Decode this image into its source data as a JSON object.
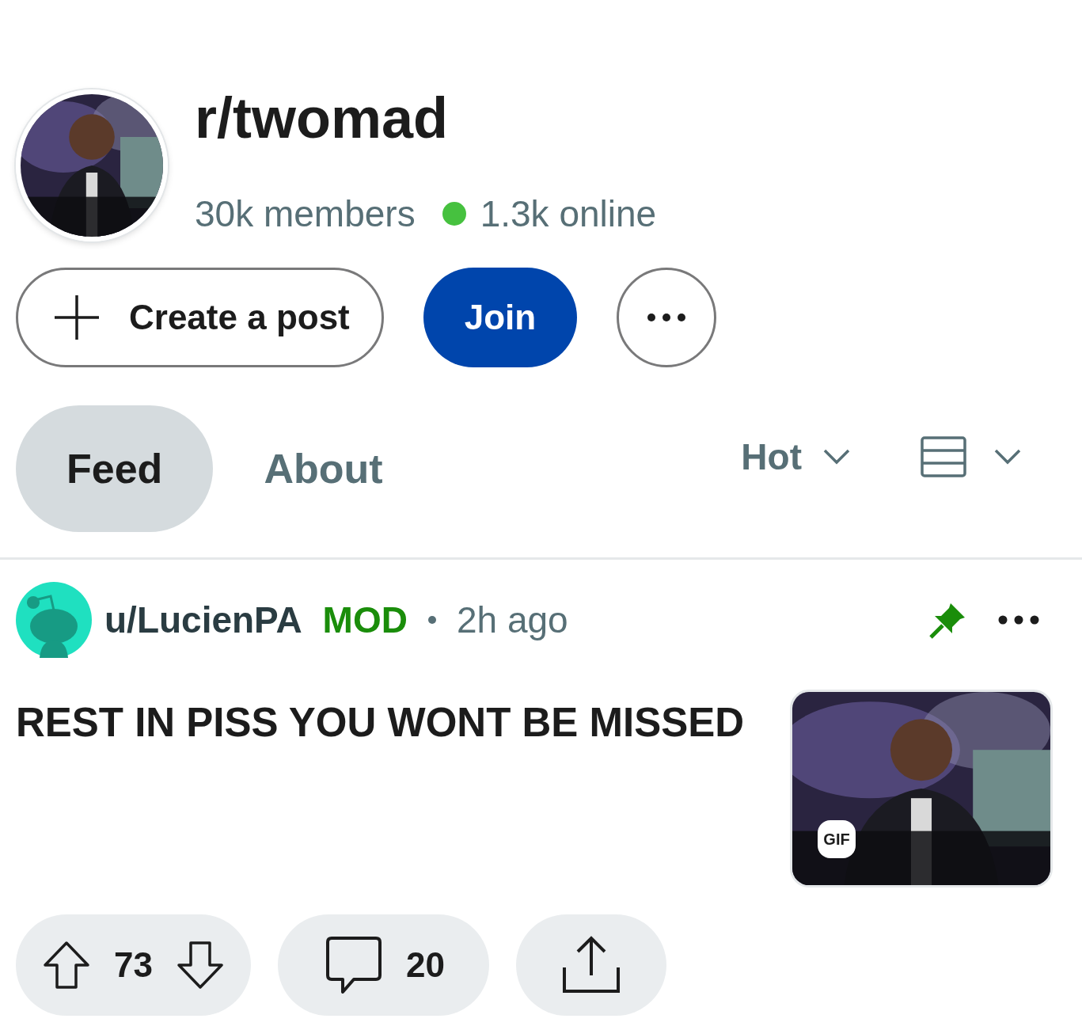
{
  "community": {
    "name": "r/twomad",
    "members": "30k members",
    "online": "1.3k online"
  },
  "actions": [
    {
      "kind": "create",
      "label": "Create a post"
    },
    {
      "kind": "join",
      "label": "Join"
    },
    {
      "kind": "more"
    }
  ],
  "tabs": [
    {
      "label": "Feed",
      "selected": true
    },
    {
      "label": "About",
      "selected": false
    }
  ],
  "sort": {
    "label": "Hot"
  },
  "post": {
    "author": "u/LucienPA",
    "flair": "MOD",
    "time": "2h ago",
    "pinned": true,
    "title": "REST IN PISS YOU WONT BE MISSED",
    "thumbnail": {
      "kind": "picture",
      "badge": "GIF"
    },
    "votes": "73",
    "comments": "20"
  }
}
